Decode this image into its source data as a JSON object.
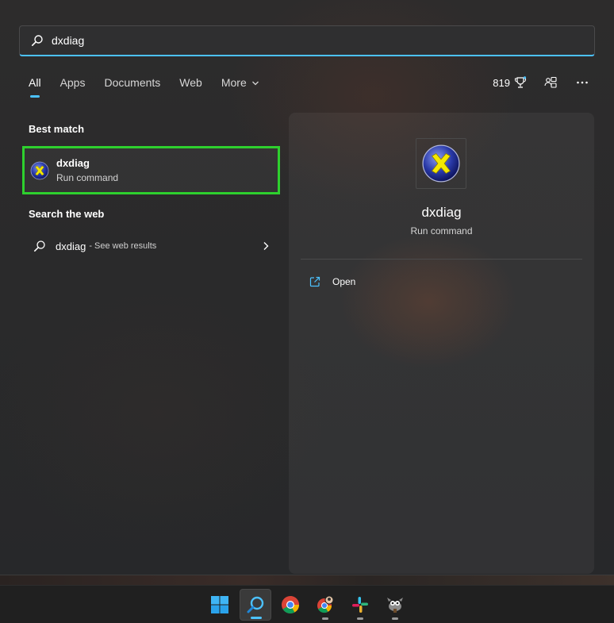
{
  "search": {
    "value": "dxdiag"
  },
  "tabs": [
    {
      "label": "All",
      "active": true
    },
    {
      "label": "Apps"
    },
    {
      "label": "Documents"
    },
    {
      "label": "Web"
    },
    {
      "label": "More"
    }
  ],
  "top_right": {
    "points": "819"
  },
  "best_match": {
    "section_title": "Best match",
    "name": "dxdiag",
    "subtitle": "Run command"
  },
  "web_search": {
    "section_title": "Search the web",
    "query": "dxdiag",
    "suffix": "- See web results"
  },
  "details": {
    "name": "dxdiag",
    "subtitle": "Run command",
    "actions": [
      {
        "label": "Open"
      }
    ]
  },
  "taskbar": {
    "items": [
      "start",
      "search",
      "chrome",
      "chrome-profile",
      "slack",
      "gimp"
    ]
  },
  "colors": {
    "accent": "#4cc2ff",
    "highlight_border": "#2ed02e",
    "panel_bg": "#2c2c2d",
    "taskbar_bg": "#202020"
  }
}
